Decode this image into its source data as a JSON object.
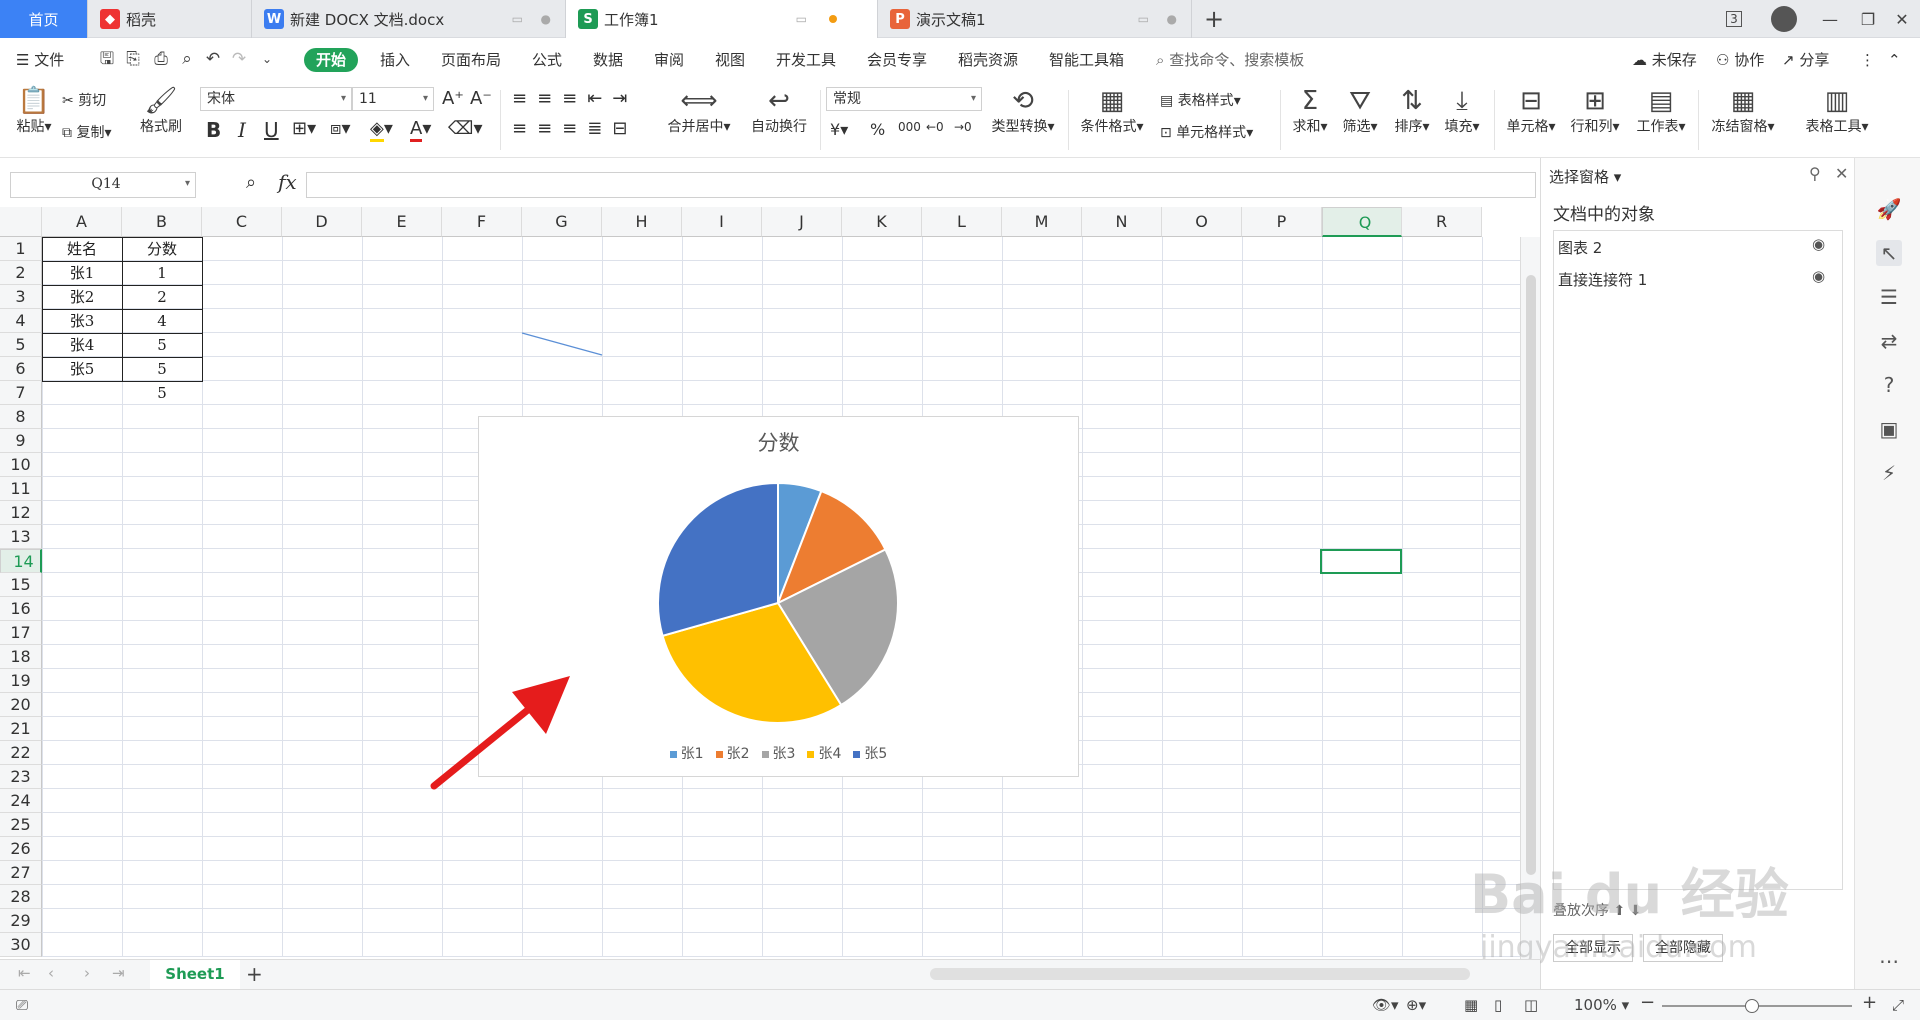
{
  "tabs": [
    {
      "label": "首页",
      "icon": "home"
    },
    {
      "label": "稻壳",
      "icon": "docer-icon"
    },
    {
      "label": "新建 DOCX 文档.docx",
      "icon": "word-icon"
    },
    {
      "label": "工作簿1",
      "icon": "sheet-icon"
    },
    {
      "label": "演示文稿1",
      "icon": "ppt-icon"
    }
  ],
  "tab_badge": "3",
  "menu": {
    "file": "文件",
    "items": [
      "开始",
      "插入",
      "页面布局",
      "公式",
      "数据",
      "审阅",
      "视图",
      "开发工具",
      "会员专享",
      "稻壳资源",
      "智能工具箱"
    ],
    "search": "查找命令、搜索模板",
    "unsaved": "未保存",
    "collab": "协作",
    "share": "分享"
  },
  "ribbon": {
    "paste": "粘贴",
    "cut": "剪切",
    "copy": "复制",
    "format_painter": "格式刷",
    "font_name": "宋体",
    "font_size": "11",
    "merge": "合并居中",
    "wrap": "自动换行",
    "number_format": "常规",
    "currency": "¥",
    "percent": "%",
    "thousands": "000",
    "type_convert": "类型转换",
    "cond_format": "条件格式",
    "table_style": "表格样式",
    "cell_style": "单元格样式",
    "sum": "求和",
    "filter": "筛选",
    "sort": "排序",
    "fill": "填充",
    "cell": "单元格",
    "rowcol": "行和列",
    "worksheet": "工作表",
    "freeze": "冻结窗格",
    "table_tools": "表格工具"
  },
  "namebox": "Q14",
  "fx": "fx",
  "columns": [
    "A",
    "B",
    "C",
    "D",
    "E",
    "F",
    "G",
    "H",
    "I",
    "J",
    "K",
    "L",
    "M",
    "N",
    "O",
    "P",
    "Q",
    "R"
  ],
  "selected_column": "Q",
  "selected_row": "14",
  "rows": [
    "1",
    "2",
    "3",
    "4",
    "5",
    "6",
    "7",
    "8",
    "9",
    "10",
    "11",
    "12",
    "13",
    "14",
    "15",
    "16",
    "17",
    "18",
    "19",
    "20",
    "21",
    "22",
    "23",
    "24",
    "25",
    "26",
    "27",
    "28",
    "29",
    "30"
  ],
  "table": {
    "header": [
      "姓名",
      "分数"
    ],
    "rows": [
      [
        "张1",
        "1"
      ],
      [
        "张2",
        "2"
      ],
      [
        "张3",
        "4"
      ],
      [
        "张4",
        "5"
      ],
      [
        "张5",
        "5"
      ]
    ],
    "extra_b7": "5"
  },
  "chart_data": {
    "type": "pie",
    "title": "分数",
    "categories": [
      "张1",
      "张2",
      "张3",
      "张4",
      "张5"
    ],
    "values": [
      1,
      2,
      4,
      5,
      5
    ],
    "colors": [
      "#5b9bd5",
      "#ed7d31",
      "#a5a5a5",
      "#ffc000",
      "#4472c4"
    ],
    "legend": "bottom"
  },
  "pane": {
    "title": "选择窗格",
    "subtitle": "文档中的对象",
    "objects": [
      "图表 2",
      "直接连接符 1"
    ],
    "order_label": "叠放次序",
    "show_all": "全部显示",
    "hide_all": "全部隐藏"
  },
  "sheet": {
    "name": "Sheet1"
  },
  "status": {
    "zoom": "100%"
  },
  "watermark": {
    "text": "Bai du 经验",
    "sub": "jingyan.baidu.com"
  }
}
